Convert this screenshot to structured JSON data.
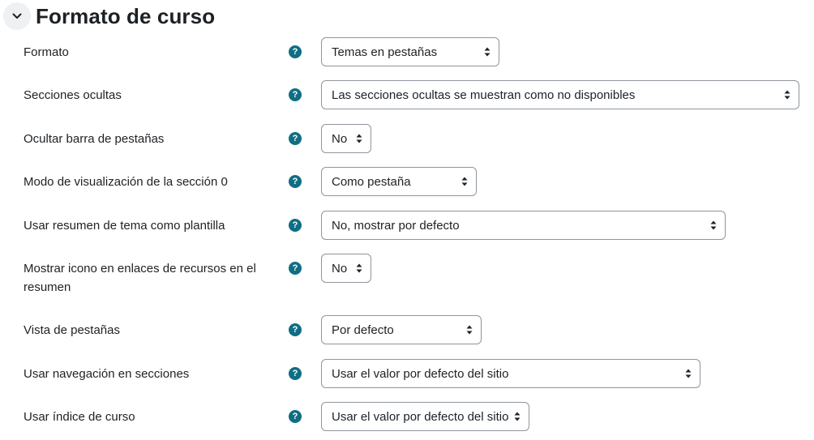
{
  "section": {
    "title": "Formato de curso",
    "toggle_icon": "chevron-down-icon"
  },
  "fields": [
    {
      "key": "formato",
      "label": "Formato",
      "value": "Temas en pestañas"
    },
    {
      "key": "secciones-ocultas",
      "label": "Secciones ocultas",
      "value": "Las secciones ocultas se muestran como no disponibles"
    },
    {
      "key": "ocultar-barra",
      "label": "Ocultar barra de pestañas",
      "value": "No"
    },
    {
      "key": "modo-seccion-0",
      "label": "Modo de visualización de la sección 0",
      "value": "Como pestaña"
    },
    {
      "key": "resumen-plantilla",
      "label": "Usar resumen de tema como plantilla",
      "value": "No, mostrar por defecto"
    },
    {
      "key": "mostrar-icono",
      "label": "Mostrar icono en enlaces de recursos en el resumen",
      "value": "No"
    },
    {
      "key": "vista-pestanas",
      "label": "Vista de pestañas",
      "value": "Por defecto"
    },
    {
      "key": "navegacion-secciones",
      "label": "Usar navegación en secciones",
      "value": "Usar el valor por defecto del sitio"
    },
    {
      "key": "indice-curso",
      "label": "Usar índice de curso",
      "value": "Usar el valor por defecto del sitio"
    }
  ],
  "help_icon": {
    "glyph": "?",
    "name": "help-icon"
  },
  "colors": {
    "help_icon_bg": "#0f6e84",
    "text": "#1d2125",
    "select_border": "#8f959e"
  }
}
